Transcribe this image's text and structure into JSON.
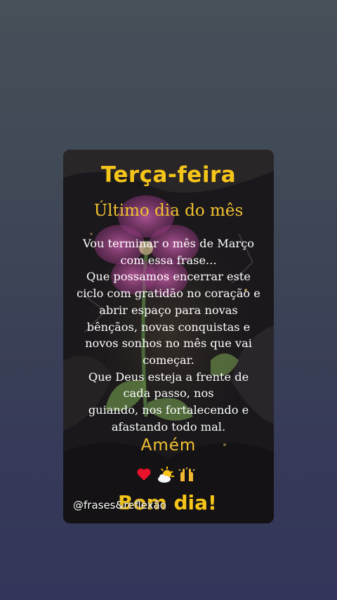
{
  "post": {
    "title": "Terça-feira",
    "subtitle": "Último dia do mês",
    "body_lines": [
      "Vou terminar o mês de  Março",
      "com essa frase...",
      "Que possamos encerrar este",
      "ciclo com gratidão no coração e",
      "abrir espaço para novas",
      "bênçãos, novas conquistas e",
      "novos sonhos no mês que vai",
      "começar.",
      "Que Deus esteja a frente de",
      "cada passo, nos",
      "guiando, nos fortalecendo e",
      "afastando todo mal."
    ],
    "closing": "Amém",
    "emojis": [
      "heart-icon",
      "sun-behind-cloud-icon",
      "raised-hands-icon"
    ],
    "greeting": "Bom dia!",
    "watermark": "@frases&reflexão"
  },
  "colors": {
    "title_yellow": "#f6c51a",
    "text_white": "#ffffff",
    "flower_pink": "#b8449a"
  }
}
